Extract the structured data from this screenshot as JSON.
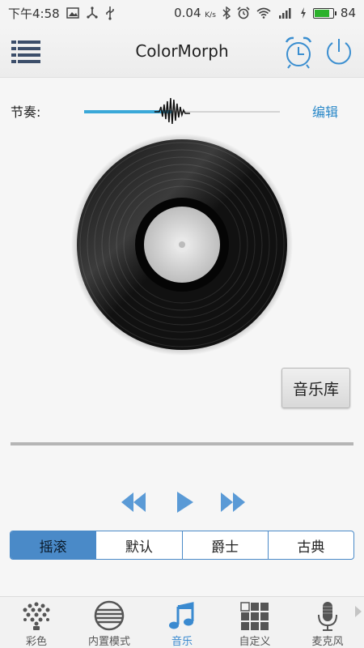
{
  "status_bar": {
    "time": "下午4:58",
    "net_speed": "0.04",
    "net_unit": "K/s",
    "battery_level": "84",
    "battery_fill": 0.84,
    "icons": [
      "image-icon",
      "usb-tether-icon",
      "usb-icon",
      "bluetooth-icon",
      "alarm-icon",
      "wifi-icon",
      "signal-icon",
      "charging-icon",
      "battery-icon"
    ]
  },
  "app_bar": {
    "title": "ColorMorph",
    "menu_icon": "list-menu-icon",
    "alarm_icon": "alarm-clock-icon",
    "power_icon": "power-icon"
  },
  "rhythm": {
    "label": "节奏:",
    "value": 0.45,
    "edit_label": "编辑"
  },
  "player": {
    "music_library_label": "音乐库",
    "progress": 0,
    "prev_icon": "rewind-icon",
    "play_icon": "play-icon",
    "next_icon": "fast-forward-icon"
  },
  "genres": {
    "tabs": [
      {
        "label": "摇滚",
        "active": true
      },
      {
        "label": "默认",
        "active": false
      },
      {
        "label": "爵士",
        "active": false
      },
      {
        "label": "古典",
        "active": false
      }
    ]
  },
  "bottom_nav": {
    "items": [
      {
        "label": "彩色",
        "icon": "color-dots-icon",
        "active": false
      },
      {
        "label": "内置模式",
        "icon": "pattern-disc-icon",
        "active": false
      },
      {
        "label": "音乐",
        "icon": "music-note-icon",
        "active": true
      },
      {
        "label": "自定义",
        "icon": "grid-icon",
        "active": false
      },
      {
        "label": "麦克风",
        "icon": "microphone-icon",
        "active": false
      }
    ]
  },
  "colors": {
    "accent": "#4a8ac8",
    "slider_blue": "#3aa8d8",
    "link_blue": "#2a88c8",
    "battery_green": "#2bb12b"
  }
}
